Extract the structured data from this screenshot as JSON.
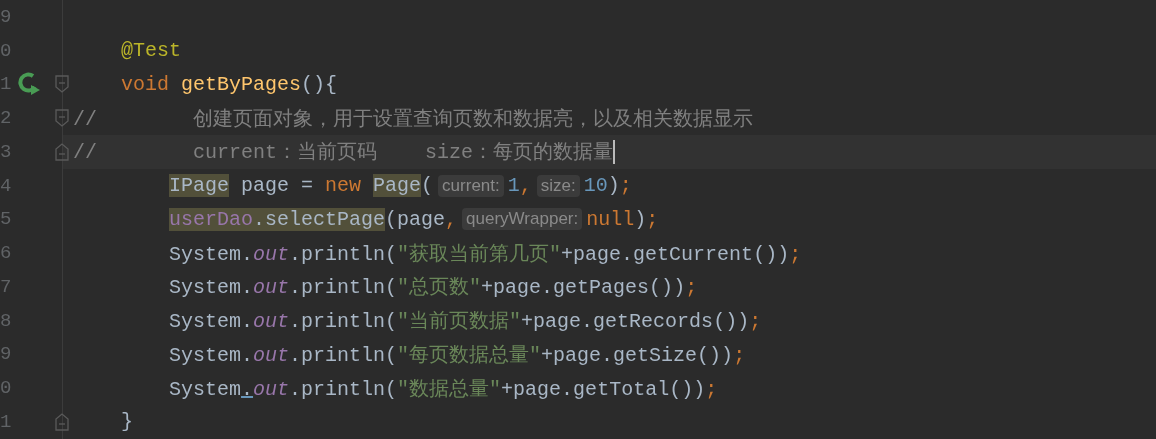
{
  "editor": {
    "lines": [
      {
        "number": "9",
        "current": false
      },
      {
        "number": "0",
        "current": false,
        "segments": [
          {
            "kind": "code",
            "tokens": [
              {
                "text": "    @Test",
                "kind": "annotation"
              }
            ]
          }
        ]
      },
      {
        "number": "1",
        "current": false,
        "gutter_icons": [
          {
            "kind": "run"
          },
          {
            "kind": "fold_start"
          }
        ],
        "segments": [
          {
            "kind": "code",
            "tokens": [
              {
                "text": "    void ",
                "kind": "keyword"
              },
              {
                "text": "getByPages",
                "kind": "method"
              },
              {
                "text": "(){",
                "kind": "plain"
              }
            ]
          }
        ]
      },
      {
        "number": "2",
        "current": false,
        "gutter_icons": [
          {
            "kind": "fold_start"
          }
        ],
        "segments": [
          {
            "kind": "code",
            "tokens": [
              {
                "text": "//        创建页面对象，用于设置查询页数和数据亮，以及相关数据显示",
                "kind": "comment"
              }
            ]
          }
        ]
      },
      {
        "number": "3",
        "current": true,
        "gutter_icons": [
          {
            "kind": "fold_end"
          }
        ],
        "segments": [
          {
            "kind": "code",
            "tokens": [
              {
                "text": "//        current：当前页码    size：每页的数据量",
                "kind": "comment"
              }
            ]
          }
        ]
      },
      {
        "number": "4",
        "current": false,
        "segments": [
          {
            "kind": "code",
            "tokens": [
              {
                "text": "        IPage",
                "kind": "plain",
                "highlighted": true
              },
              {
                "text": " page = ",
                "kind": "plain"
              },
              {
                "text": "new ",
                "kind": "keyword"
              },
              {
                "text": "Page",
                "kind": "plain",
                "highlighted": true
              },
              {
                "text": "(",
                "kind": "plain"
              }
            ]
          },
          {
            "kind": "hint",
            "text": "current:"
          },
          {
            "kind": "code",
            "tokens": [
              {
                "text": "1",
                "kind": "number"
              },
              {
                "text": ",",
                "kind": "keyword"
              }
            ]
          },
          {
            "kind": "hint",
            "text": "size:"
          },
          {
            "kind": "code",
            "tokens": [
              {
                "text": "10",
                "kind": "number"
              },
              {
                "text": ")",
                "kind": "plain"
              },
              {
                "text": ";",
                "kind": "keyword"
              }
            ]
          }
        ]
      },
      {
        "number": "5",
        "current": false,
        "segments": [
          {
            "kind": "code",
            "tokens": [
              {
                "text": "        userDao",
                "kind": "field",
                "highlighted": true
              },
              {
                "text": ".selectPage",
                "kind": "plain",
                "highlighted": true
              },
              {
                "text": "(page",
                "kind": "plain"
              },
              {
                "text": ",",
                "kind": "keyword"
              }
            ]
          },
          {
            "kind": "hint",
            "text": "queryWrapper:"
          },
          {
            "kind": "code",
            "tokens": [
              {
                "text": "null",
                "kind": "keyword"
              },
              {
                "text": ")",
                "kind": "plain"
              },
              {
                "text": ";",
                "kind": "keyword"
              }
            ]
          }
        ]
      },
      {
        "number": "6",
        "current": false,
        "segments": [
          {
            "kind": "code",
            "tokens": [
              {
                "text": "        System.",
                "kind": "plain"
              },
              {
                "text": "out",
                "kind": "static"
              },
              {
                "text": ".println(",
                "kind": "plain"
              },
              {
                "text": "\"获取当前第几页\"",
                "kind": "string"
              },
              {
                "text": "+page.getCurrent())",
                "kind": "plain"
              },
              {
                "text": ";",
                "kind": "keyword"
              }
            ]
          }
        ]
      },
      {
        "number": "7",
        "current": false,
        "segments": [
          {
            "kind": "code",
            "tokens": [
              {
                "text": "        System.",
                "kind": "plain"
              },
              {
                "text": "out",
                "kind": "static"
              },
              {
                "text": ".println(",
                "kind": "plain"
              },
              {
                "text": "\"总页数\"",
                "kind": "string"
              },
              {
                "text": "+page.getPages())",
                "kind": "plain"
              },
              {
                "text": ";",
                "kind": "keyword"
              }
            ]
          }
        ]
      },
      {
        "number": "8",
        "current": false,
        "segments": [
          {
            "kind": "code",
            "tokens": [
              {
                "text": "        System.",
                "kind": "plain"
              },
              {
                "text": "out",
                "kind": "static"
              },
              {
                "text": ".println(",
                "kind": "plain"
              },
              {
                "text": "\"当前页数据\"",
                "kind": "string"
              },
              {
                "text": "+page.getRecords())",
                "kind": "plain"
              },
              {
                "text": ";",
                "kind": "keyword"
              }
            ]
          }
        ]
      },
      {
        "number": "9",
        "current": false,
        "segments": [
          {
            "kind": "code",
            "tokens": [
              {
                "text": "        System.",
                "kind": "plain"
              },
              {
                "text": "out",
                "kind": "static"
              },
              {
                "text": ".println(",
                "kind": "plain"
              },
              {
                "text": "\"每页数据总量\"",
                "kind": "string"
              },
              {
                "text": "+page.getSize())",
                "kind": "plain"
              },
              {
                "text": ";",
                "kind": "keyword"
              }
            ]
          }
        ]
      },
      {
        "number": "0",
        "current": false,
        "segments": [
          {
            "kind": "code",
            "tokens": [
              {
                "text": "        System",
                "kind": "plain"
              },
              {
                "text": ".",
                "kind": "plain",
                "underlined": true
              },
              {
                "text": "out",
                "kind": "static"
              },
              {
                "text": ".println(",
                "kind": "plain"
              },
              {
                "text": "\"数据总量\"",
                "kind": "string"
              },
              {
                "text": "+page.getTotal())",
                "kind": "plain"
              },
              {
                "text": ";",
                "kind": "keyword"
              }
            ]
          }
        ]
      },
      {
        "number": "1",
        "current": false,
        "gutter_icons": [
          {
            "kind": "fold_end"
          }
        ],
        "segments": [
          {
            "kind": "code",
            "tokens": [
              {
                "text": "    }",
                "kind": "plain"
              }
            ]
          }
        ]
      }
    ]
  }
}
